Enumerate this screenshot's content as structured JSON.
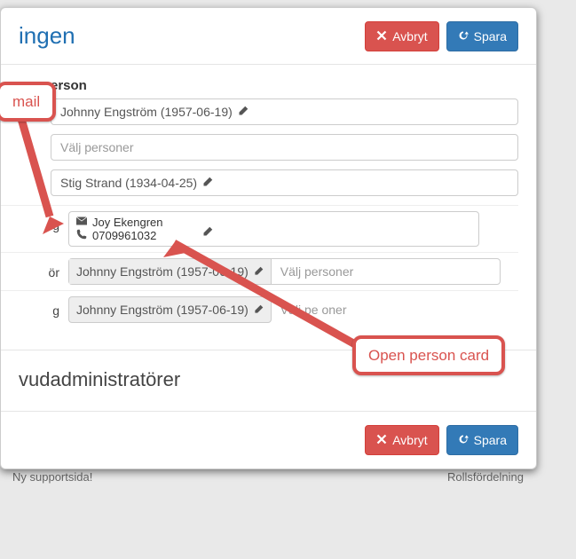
{
  "colors": {
    "primary": "#337ab7",
    "danger": "#d9534f"
  },
  "header": {
    "title_fragment": "ingen",
    "cancel_label": "Avbryt",
    "save_label": "Spara"
  },
  "section": {
    "person_heading_fragment": "erson"
  },
  "fields": {
    "row1_value": "Johnny Engström (1957-06-19)",
    "placeholder": "Välj personer",
    "row3_value": "Stig Strand (1934-04-25)"
  },
  "rows": {
    "r_contact_left_fragment": "ig",
    "contact_name": "Joy Ekengren",
    "contact_phone": "0709961032",
    "r_tor_left_fragment": "ör",
    "r_tor_chip": "Johnny Engström (1957-06-19)",
    "r_tor_placeholder": "Välj personer",
    "r_g_left_fragment": "g",
    "r_g_chip": "Johnny Engström (1957-06-19)",
    "r_g_placeholder_fragment": "Välj pe       oner"
  },
  "admins": {
    "heading_fragment": "vudadministratörer"
  },
  "footer": {
    "cancel_label": "Avbryt",
    "save_label": "Spara"
  },
  "callouts": {
    "mail_fragment": "mail",
    "open_card": "Open person card"
  },
  "background": {
    "left_text": "Ny supportsida!",
    "right_text": "Rollsfördelning"
  }
}
